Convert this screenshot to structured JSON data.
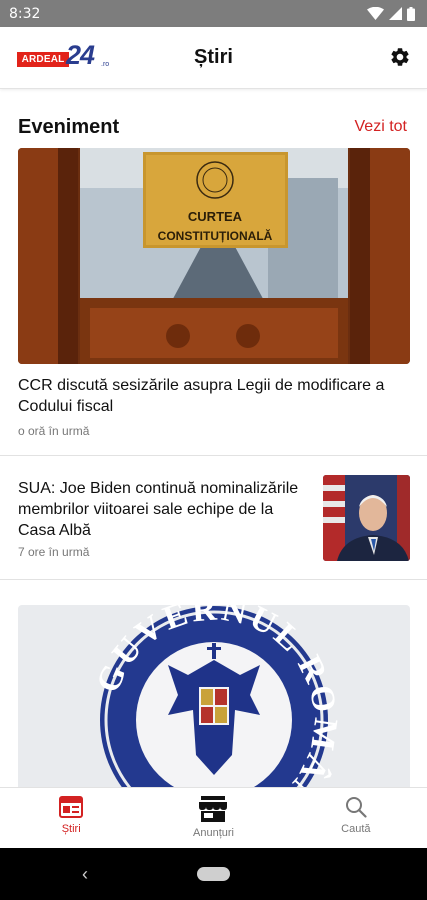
{
  "status_bar": {
    "time": "8:32",
    "icons": [
      "wifi-icon",
      "signal-icon",
      "battery-icon"
    ]
  },
  "app_bar": {
    "logo_text": "ARDEAL",
    "logo_number": "24",
    "logo_suffix": ".ro",
    "title": "Știri",
    "settings_icon": "gear-icon"
  },
  "section": {
    "title": "Eveniment",
    "see_all": "Vezi tot"
  },
  "articles": [
    {
      "title": "CCR discută sesizările asupra Legii de modificare a Codului fiscal",
      "time": "o oră în urmă",
      "image_sign_line1": "CURTEA",
      "image_sign_line2": "CONSTITUȚIONALĂ"
    },
    {
      "title": "SUA: Joe Biden continuă nominalizările membrilor viitoarei sale echipe de la Casa Albă",
      "time": "7 ore în urmă"
    },
    {
      "image_seal_text": "GUVERNUL ROMÂNIEI"
    }
  ],
  "bottom_nav": [
    {
      "label": "Știri",
      "icon": "newspaper-icon",
      "active": true
    },
    {
      "label": "Anunțuri",
      "icon": "store-icon",
      "active": false
    },
    {
      "label": "Caută",
      "icon": "search-icon",
      "active": false
    }
  ],
  "colors": {
    "accent": "#d32222",
    "status_bar": "#7d7d7d",
    "logo_blue": "#2a3d8f"
  }
}
